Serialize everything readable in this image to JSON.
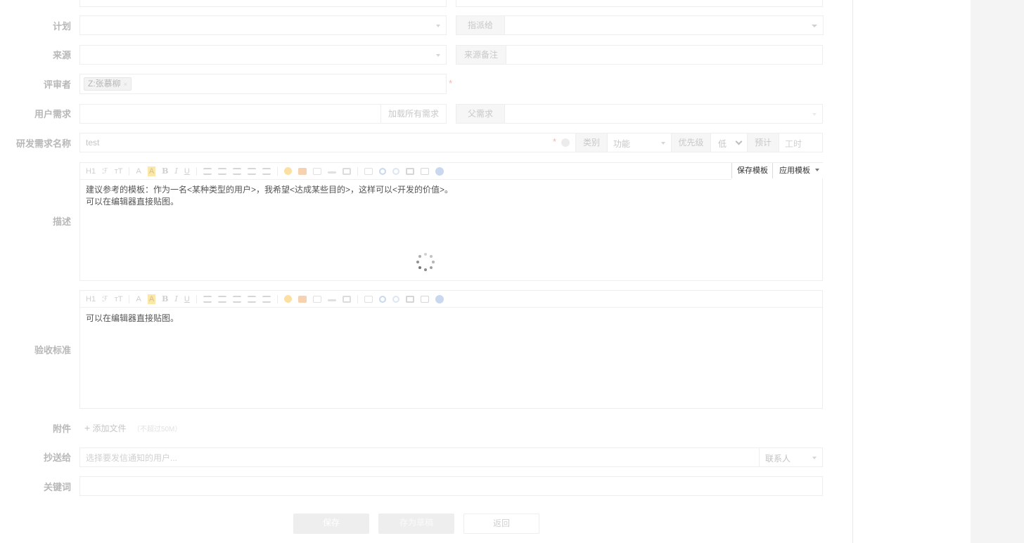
{
  "form": {
    "plan_label": "计划",
    "assign_to_label": "指派给",
    "source_label": "来源",
    "source_note_label": "来源备注",
    "reviewer_label": "评审者",
    "reviewer_tag": "Z:张慕柳",
    "reviewer_tag_remove": "×",
    "required_mark": "*",
    "user_story_label": "用户需求",
    "load_all_label": "加载所有需求",
    "parent_label": "父需求",
    "name_label": "研发需求名称",
    "name_value": "test",
    "category_label": "类别",
    "category_value": "功能",
    "priority_label": "优先级",
    "priority_value": "低",
    "estimate_label": "预计",
    "estimate_placeholder": "工时",
    "description_label": "描述",
    "description_text_1": "建议参考的模板：作为一名<某种类型的用户>，我希望<达成某些目的>，这样可以<开发的价值>。",
    "description_text_2": "可以在编辑器直接贴图。",
    "save_template_label": "保存模板",
    "apply_template_label": "应用模板",
    "acceptance_label": "验收标准",
    "acceptance_text": "可以在编辑器直接贴图。",
    "attachment_label": "附件",
    "add_file_label": "添加文件",
    "file_limit_note": "（不超过50M）",
    "cc_label": "抄送给",
    "cc_placeholder": "选择要发信通知的用户...",
    "contacts_label": "联系人",
    "keywords_label": "关键词"
  },
  "toolbar": {
    "heading": "H1",
    "font_family": "ℱ",
    "font_size": "тT",
    "font_color": "A",
    "highlight": "A",
    "bold": "B",
    "italic": "I",
    "underline": "U"
  },
  "buttons": {
    "save_label": "保存",
    "save_draft_label": "存为草稿",
    "back_label": "返回"
  },
  "colors": {
    "highlight_yellow": "#fbe7a7",
    "icon_blue": "#c9d8ef",
    "disabled_button": "#eeeeee"
  },
  "icons": [
    "caret-down-icon",
    "plus-icon",
    "close-icon",
    "loading-spinner-icon",
    "emoji-icon",
    "image-icon",
    "link-icon",
    "table-icon",
    "undo-icon",
    "redo-icon",
    "fullscreen-icon",
    "help-icon"
  ]
}
